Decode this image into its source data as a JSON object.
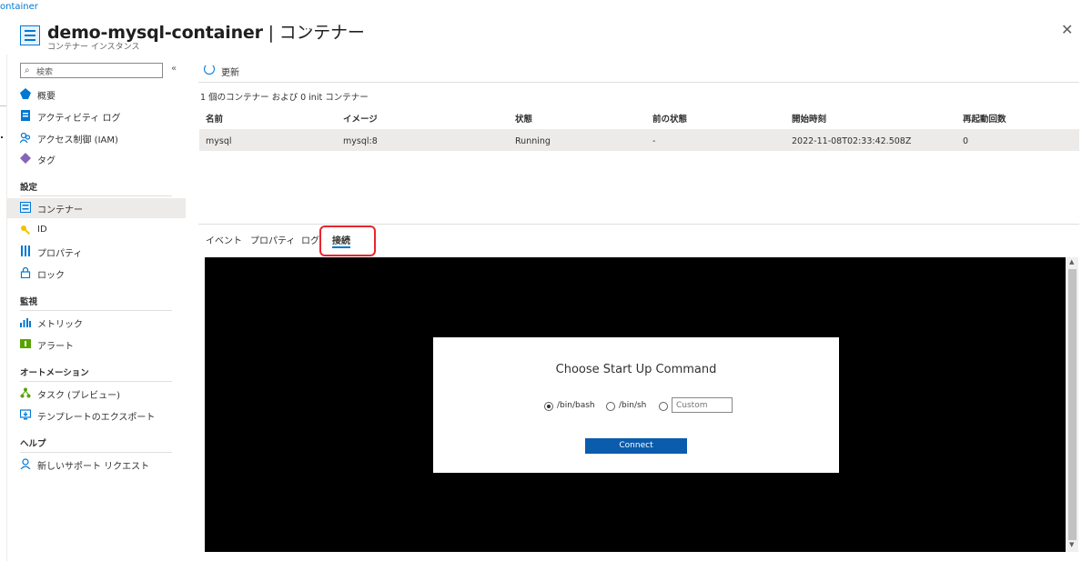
{
  "breadcrumb": "ontainer",
  "header": {
    "title": "demo-mysql-container",
    "separator": " | ",
    "title_suffix": "コンテナー",
    "subtitle": "コンテナー インスタンス",
    "more": "···",
    "close": "✕"
  },
  "sidebar": {
    "search_placeholder": "検索",
    "collapse": "«",
    "items": [
      {
        "label": "概要"
      },
      {
        "label": "アクティビティ ログ"
      },
      {
        "label": "アクセス制御 (IAM)"
      },
      {
        "label": "タグ"
      }
    ],
    "sections": [
      {
        "heading": "設定",
        "items": [
          {
            "label": "コンテナー",
            "selected": true
          },
          {
            "label": "ID"
          },
          {
            "label": "プロパティ"
          },
          {
            "label": "ロック"
          }
        ]
      },
      {
        "heading": "監視",
        "items": [
          {
            "label": "メトリック"
          },
          {
            "label": "アラート"
          }
        ]
      },
      {
        "heading": "オートメーション",
        "items": [
          {
            "label": "タスク (プレビュー)"
          },
          {
            "label": "テンプレートのエクスポート"
          }
        ]
      },
      {
        "heading": "ヘルプ",
        "items": [
          {
            "label": "新しいサポート リクエスト"
          }
        ]
      }
    ]
  },
  "toolbar": {
    "refresh_label": "更新"
  },
  "summary": "1 個のコンテナー および 0 init コンテナー",
  "table": {
    "columns": [
      "名前",
      "イメージ",
      "状態",
      "前の状態",
      "開始時刻",
      "再起動回数"
    ],
    "rows": [
      [
        "mysql",
        "mysql:8",
        "Running",
        "-",
        "2022-11-08T02:33:42.508Z",
        "0"
      ]
    ]
  },
  "tabs": [
    {
      "label": "イベント"
    },
    {
      "label": "プロパティ"
    },
    {
      "label": "ログ"
    },
    {
      "label": "接続",
      "active": true
    }
  ],
  "dialog": {
    "title": "Choose Start Up Command",
    "options": [
      {
        "label": "/bin/bash",
        "selected": true
      },
      {
        "label": "/bin/sh",
        "selected": false
      },
      {
        "label": "",
        "selected": false
      }
    ],
    "custom_placeholder": "Custom",
    "connect_label": "Connect"
  },
  "colors": {
    "accent": "#0078d4",
    "connect_button": "#0b5cad",
    "highlight": "#e8262d",
    "terminal_bg": "#000000"
  }
}
